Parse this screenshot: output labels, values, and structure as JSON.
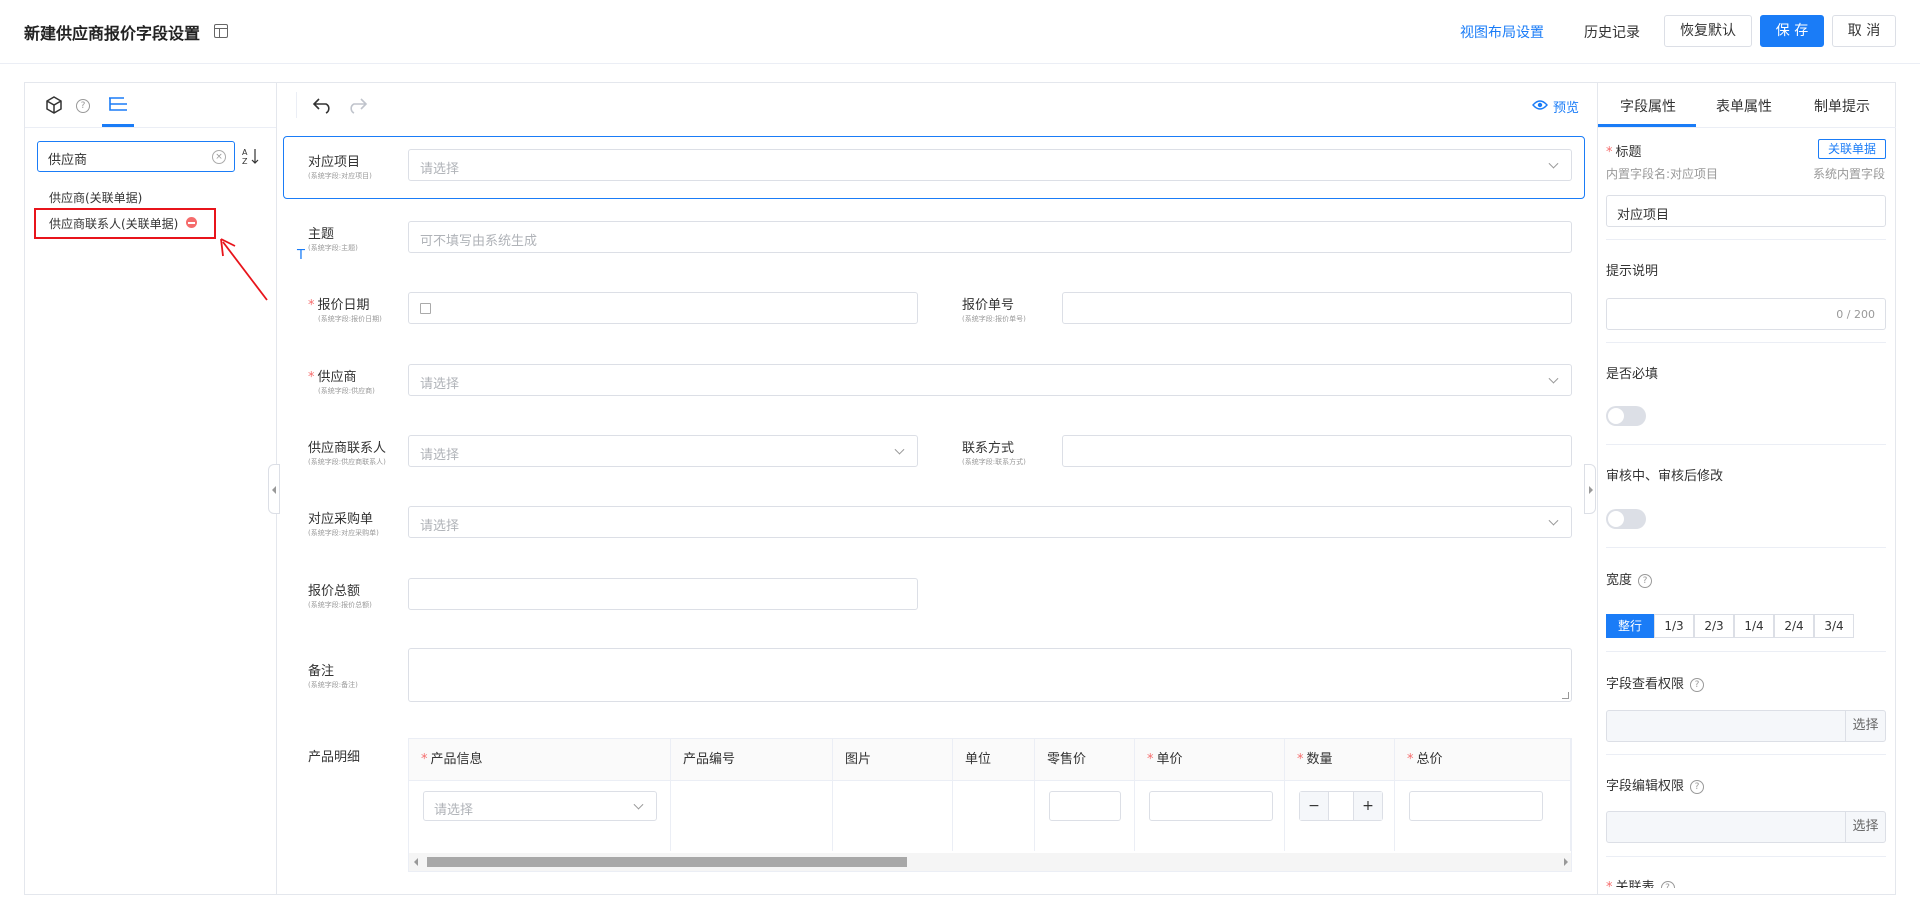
{
  "header": {
    "title": "新建供应商报价字段设置",
    "view_layout": "视图布局设置",
    "history": "历史记录",
    "restore_default": "恢复默认",
    "save": "保 存",
    "cancel": "取 消"
  },
  "left": {
    "search_value": "供应商",
    "results": [
      "供应商(关联单据)",
      "供应商联系人(关联单据)"
    ]
  },
  "toolbar": {
    "preview": "预览"
  },
  "form": {
    "fields": [
      {
        "label": "对应项目",
        "sub": "(系统字段:对应项目)",
        "placeholder": "请选择",
        "required": false
      },
      {
        "label": "主题",
        "sub": "(系统字段:主题)",
        "placeholder": "可不填写由系统生成",
        "required": false
      },
      {
        "label": "报价日期",
        "sub": "(系统字段:报价日期)",
        "placeholder": "",
        "required": true
      },
      {
        "label": "报价单号",
        "sub": "(系统字段:报价单号)",
        "placeholder": "",
        "required": false
      },
      {
        "label": "供应商",
        "sub": "(系统字段:供应商)",
        "placeholder": "请选择",
        "required": true
      },
      {
        "label": "供应商联系人",
        "sub": "(系统字段:供应商联系人)",
        "placeholder": "请选择",
        "required": false
      },
      {
        "label": "联系方式",
        "sub": "(系统字段:联系方式)",
        "placeholder": "",
        "required": false
      },
      {
        "label": "对应采购单",
        "sub": "(系统字段:对应采购单)",
        "placeholder": "请选择",
        "required": false
      },
      {
        "label": "报价总额",
        "sub": "(系统字段:报价总额)",
        "placeholder": "",
        "required": false
      },
      {
        "label": "备注",
        "sub": "(系统字段:备注)",
        "placeholder": "",
        "required": false
      }
    ],
    "product_label": "产品明细",
    "table_headers": [
      "产品信息",
      "产品编号",
      "图片",
      "单位",
      "零售价",
      "单价",
      "数量",
      "总价"
    ],
    "row_select_placeholder": "请选择",
    "minus": "−",
    "plus": "+"
  },
  "right": {
    "tabs": [
      "字段属性",
      "表单属性",
      "制单提示"
    ],
    "title_label": "标题",
    "relation_tag": "关联单据",
    "builtin_name": "内置字段名:对应项目",
    "system_builtin": "系统内置字段",
    "title_value": "对应项目",
    "hint_label": "提示说明",
    "hint_counter": "0 / 200",
    "required_label": "是否必填",
    "audit_label": "审核中、审核后修改",
    "width_label": "宽度",
    "width_options": [
      "整行",
      "1/3",
      "2/3",
      "1/4",
      "2/4",
      "3/4"
    ],
    "view_perm_label": "字段查看权限",
    "edit_perm_label": "字段编辑权限",
    "choose": "选择",
    "relation_table_label": "关联表",
    "q_mark": "?"
  },
  "colors": {
    "primary": "#1a7cf7",
    "danger": "#f56c6c",
    "highlight": "#e8141b"
  }
}
